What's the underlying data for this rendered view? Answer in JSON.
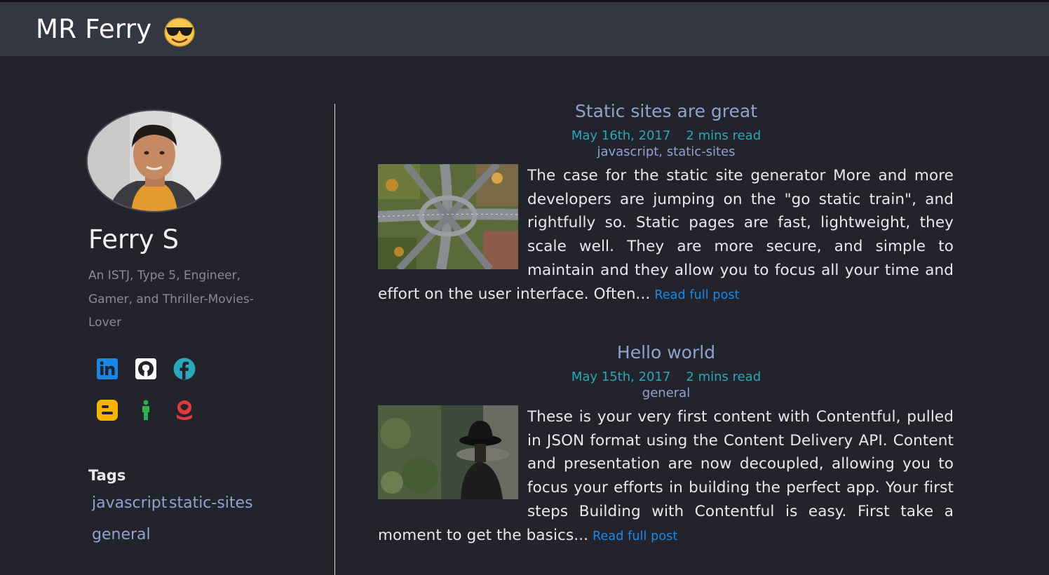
{
  "header": {
    "site_title": "MR Ferry",
    "emoji_icon": "smiling-face-with-sunglasses-icon"
  },
  "sidebar": {
    "author_name": "Ferry S",
    "bio": "An ISTJ, Type 5, Engineer, Gamer, and Thriller-Movies-Lover",
    "social_links": [
      {
        "name": "linkedin-icon",
        "color": "#1a86e6"
      },
      {
        "name": "github-icon",
        "color": "#ffffff"
      },
      {
        "name": "facebook-icon",
        "color": "#2aa7b9"
      },
      {
        "name": "blogger-icon",
        "color": "#f4b400"
      },
      {
        "name": "person-icon",
        "color": "#2bb24c"
      },
      {
        "name": "space-helmet-icon",
        "color": "#e0393e"
      }
    ],
    "tags_title": "Tags",
    "tags": [
      "javascript",
      "static-sites",
      "general"
    ]
  },
  "posts": [
    {
      "title": "Static sites are great",
      "date": "May 16th, 2017",
      "read_time": "2 mins read",
      "tags": "javascript, static-sites",
      "excerpt": "The case for the static site generator More and more developers are jumping on the \"go static train\", and rightfully so. Static pages are fast, lightweight, they scale well. They are more secure, and simple to maintain and they allow you to focus all your time and effort on the user interface. Often...",
      "read_more": "Read full post",
      "image_icon": "highway-interchange-image"
    },
    {
      "title": "Hello world",
      "date": "May 15th, 2017",
      "read_time": "2 mins read",
      "tags": "general",
      "excerpt": "These is your very first content with Contentful, pulled in JSON format using the Content Delivery API. Content and presentation are now decoupled, allowing you to focus your efforts in building the perfect app. Your first steps Building with Contentful is easy. First take a moment to get the basics...",
      "read_more": "Read full post",
      "image_icon": "woman-in-hat-image"
    }
  ],
  "colors": {
    "background": "#23232c",
    "header": "#343741",
    "title_link": "#8fa2cf",
    "meta": "#2aa7b9",
    "read_more": "#1e88e5"
  }
}
